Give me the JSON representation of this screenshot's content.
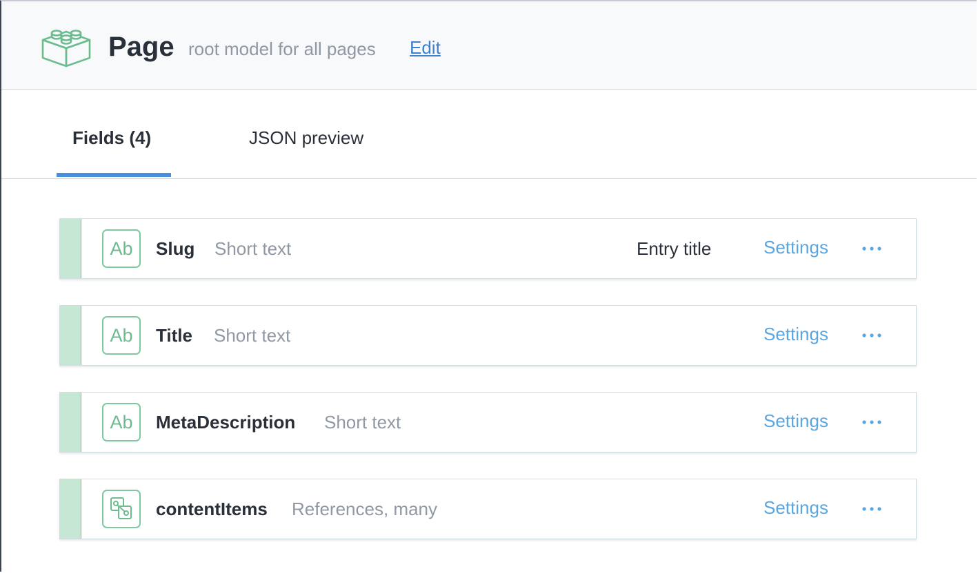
{
  "header": {
    "icon": "lego-block-icon",
    "title": "Page",
    "description": "root model for all pages",
    "edit_label": "Edit"
  },
  "tabs": [
    {
      "label": "Fields (4)",
      "active": true
    },
    {
      "label": "JSON preview",
      "active": false
    }
  ],
  "fields": [
    {
      "icon": "short-text-icon",
      "icon_text": "Ab",
      "name": "Slug",
      "type": "Short text",
      "badge": "Entry title",
      "settings_label": "Settings",
      "more_icon": "ellipsis-icon"
    },
    {
      "icon": "short-text-icon",
      "icon_text": "Ab",
      "name": "Title",
      "type": "Short text",
      "badge": "",
      "settings_label": "Settings",
      "more_icon": "ellipsis-icon"
    },
    {
      "icon": "short-text-icon",
      "icon_text": "Ab",
      "name": "MetaDescription",
      "type": "Short text",
      "badge": "",
      "settings_label": "Settings",
      "more_icon": "ellipsis-icon"
    },
    {
      "icon": "references-icon",
      "icon_text": "",
      "name": "contentItems",
      "type": "References, many",
      "badge": "",
      "settings_label": "Settings",
      "more_icon": "ellipsis-icon"
    }
  ],
  "colors": {
    "accent_green": "#6cbc90",
    "handle_green": "#c6e7d4",
    "link_blue": "#5aa6e0",
    "tab_underline": "#4a8fdb"
  }
}
